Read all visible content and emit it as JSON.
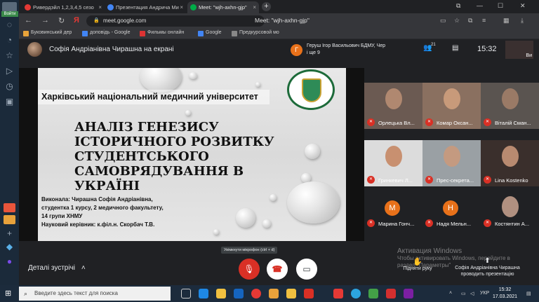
{
  "sidebar": {
    "top_label": "Войти",
    "icons": [
      "chat-icon",
      "bell-icon",
      "star-icon",
      "play-icon",
      "clock-icon",
      "box-icon"
    ]
  },
  "tabs": [
    {
      "label": "Ривердэйл 1,2,3,4,5 сезо",
      "color": "#e53935"
    },
    {
      "label": "Презентация Андрича Ми",
      "color": "#4285f4"
    },
    {
      "label": "Meet: \"wjh-axhn-gjp\"",
      "color": "#00ac47"
    }
  ],
  "address": {
    "url": "meet.google.com",
    "page_title": "Meet: \"wjh-axhn-gjp\""
  },
  "bookmarks": [
    {
      "label": "Буковинський дер",
      "color": "#e8a33a"
    },
    {
      "label": "доповідь - Google",
      "color": "#4285f4"
    },
    {
      "label": "Фильмы онлайн",
      "color": "#d33"
    },
    {
      "label": "Google",
      "color": "#4285f4"
    },
    {
      "label": "Предкурсовой мо",
      "color": "#888"
    }
  ],
  "meet": {
    "presenter_text": "Софія Андріанівна Чирашна на екрані",
    "notification": {
      "initial": "Г",
      "line1": "Геруш Ігор Васильович БДМУ, Чер",
      "line2": "і ще 9"
    },
    "participant_count": "21",
    "time": "15:32",
    "self_label": "Ви"
  },
  "slide": {
    "university": "Харківський національний медичний університет",
    "title": "АНАЛІЗ ГЕНЕЗИСУ ІСТОРИЧНОГО РОЗВИТКУ СТУДЕНТСЬКОГО САМОВРЯДУВАННЯ В УКРАЇНІ",
    "info1": "Виконала: Чирашна Софія Андріанівна,",
    "info2": "студентка 1 курсу, 2 медичного факультету,",
    "info3": "14 групи ХНМУ",
    "info4": "Науковий керівник: к.філ.н. Скорбач Т.В."
  },
  "participants": [
    {
      "name": "Орлецька Вл...",
      "bg": "#6b5a52",
      "face": "#b08870"
    },
    {
      "name": "Комар Оксан...",
      "bg": "#8a7060",
      "face": "#c89a7a"
    },
    {
      "name": "Віталій Сман...",
      "bg": "#5a5450",
      "face": "#9a7a66"
    },
    {
      "name": "Гринкевич Л...",
      "bg": "#dcdcdc",
      "face": "#c89070"
    },
    {
      "name": "Прес-секрета...",
      "bg": "#9aa0a4",
      "face": "#c49a80"
    },
    {
      "name": "Lina Kostenko",
      "bg": "#3a2f2c",
      "face": "#b88a70"
    },
    {
      "name": "Марина Гонч...",
      "bg": "#202124",
      "initial": "М",
      "circle": "#e8711a"
    },
    {
      "name": "Надя Мельн...",
      "bg": "#202124",
      "initial": "Н",
      "circle": "#e8711a"
    },
    {
      "name": "Костянтин А...",
      "bg": "#202124",
      "face": "#b09080"
    }
  ],
  "tooltip": "Увімкнути мікрофон (ctrl + d)",
  "bottom": {
    "details": "Деталі зустрічі",
    "raise_hand": "Підняти руку",
    "present_line1": "Софія Андріанівна Чирашна",
    "present_line2": "проводить презентацію",
    "activation_line1": "Активация Windows",
    "activation_line2": "Чтобы активировать Windows, перейдите в",
    "activation_line3": "раздел \"Параметры\""
  },
  "taskbar": {
    "search_placeholder": "Введите здесь текст для поиска",
    "lang": "УКР",
    "time": "15:32",
    "date": "17.03.2021"
  }
}
